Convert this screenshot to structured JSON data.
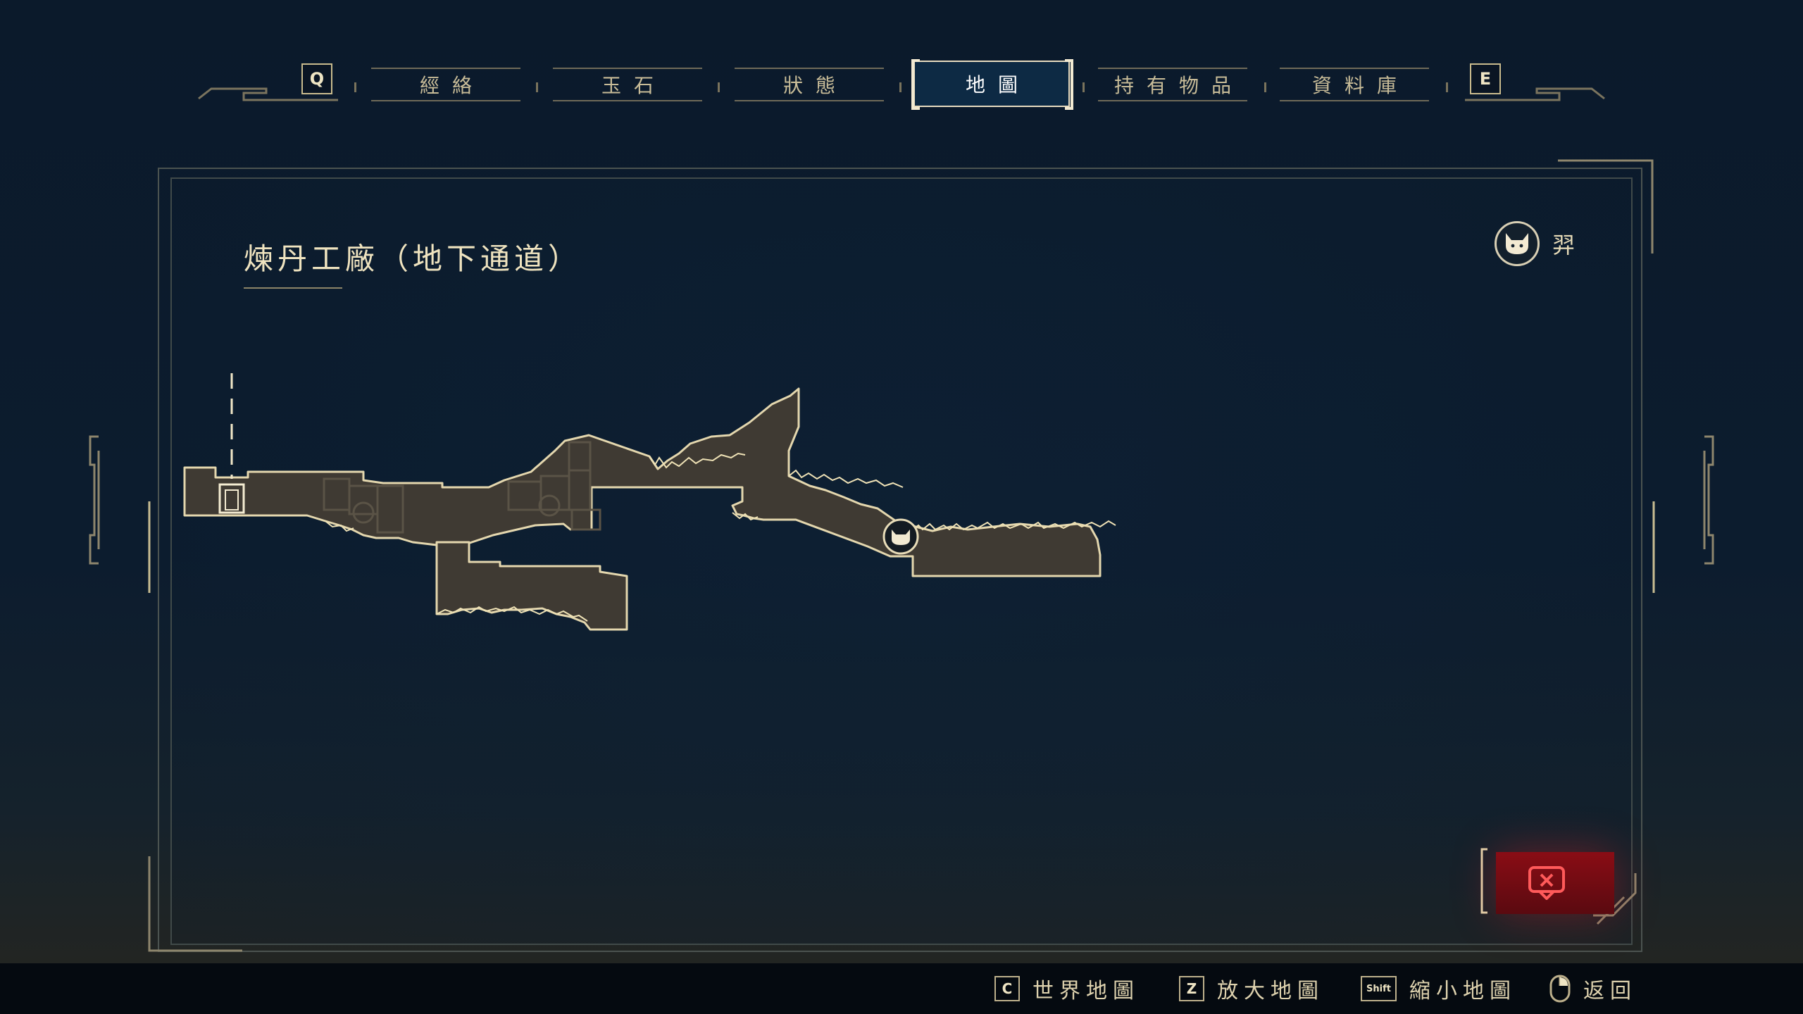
{
  "nav": {
    "left_key": "Q",
    "right_key": "E",
    "tabs": [
      {
        "label": "經絡",
        "active": false
      },
      {
        "label": "玉石",
        "active": false
      },
      {
        "label": "狀態",
        "active": false
      },
      {
        "label": "地圖",
        "active": true
      },
      {
        "label": "持有物品",
        "active": false
      },
      {
        "label": "資料庫",
        "active": false
      }
    ]
  },
  "map": {
    "title": "煉丹工廠（地下通道）",
    "player_name": "羿",
    "player_icon": "cat-face-icon",
    "marker_button_icon": "map-marker-remove-icon"
  },
  "hints": [
    {
      "key": "C",
      "label": "世界地圖"
    },
    {
      "key": "Z",
      "label": "放大地圖"
    },
    {
      "key": "Shift",
      "label": "縮小地圖"
    },
    {
      "key": "mouse-right-icon",
      "label": "返回"
    }
  ],
  "colors": {
    "background": "#0b1a2b",
    "map_fill": "#3f3a33",
    "map_outline": "#e4d7ae",
    "accent_red": "#8a0d15"
  }
}
